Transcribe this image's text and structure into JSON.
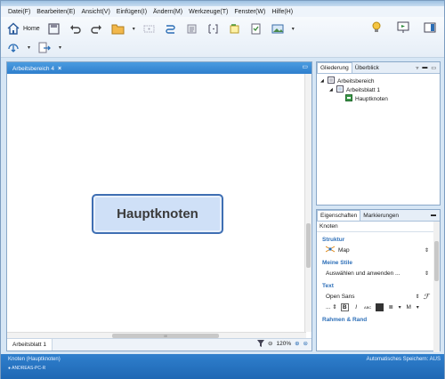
{
  "menubar": {
    "items": [
      "Datei(F)",
      "Bearbeiten(E)",
      "Ansicht(V)",
      "Einfügen(I)",
      "Ändern(M)",
      "Werkzeuge(T)",
      "Fenster(W)",
      "Hilfe(H)"
    ]
  },
  "toolbar": {
    "home_label": "Home"
  },
  "editor": {
    "tab_label": "Arbeitsbereich 4",
    "central_node": "Hauptknoten",
    "sheet_tab": "Arbeitsblatt 1",
    "zoom": "120%",
    "hscroll_marker": "III"
  },
  "outline": {
    "tabs": [
      "Gliederung",
      "Überblick"
    ],
    "tree": [
      {
        "label": "Arbeitsbereich",
        "level": 0
      },
      {
        "label": "Arbeitsblatt 1",
        "level": 1
      },
      {
        "label": "Hauptknoten",
        "level": 2
      }
    ]
  },
  "properties": {
    "tabs": [
      "Eigenschaften",
      "Markierungen"
    ],
    "header": "Knoten",
    "struktur_title": "Struktur",
    "struktur_value": "Map",
    "stile_title": "Meine Stile",
    "stile_value": "Auswählen und anwenden ...",
    "text_title": "Text",
    "font_value": "Open Sans",
    "rahmen_title": "Rahmen & Rand"
  },
  "status": {
    "left": "Knoten (Hauptknoten)",
    "user": "ANDREAS-PC-R",
    "right": "Automatisches Speichern: AUS"
  },
  "colors": {
    "accent": "#2f7fcd",
    "node_fill": "#cfe0f7",
    "node_border": "#3f6fb3",
    "section_title": "#2d6fb8"
  }
}
